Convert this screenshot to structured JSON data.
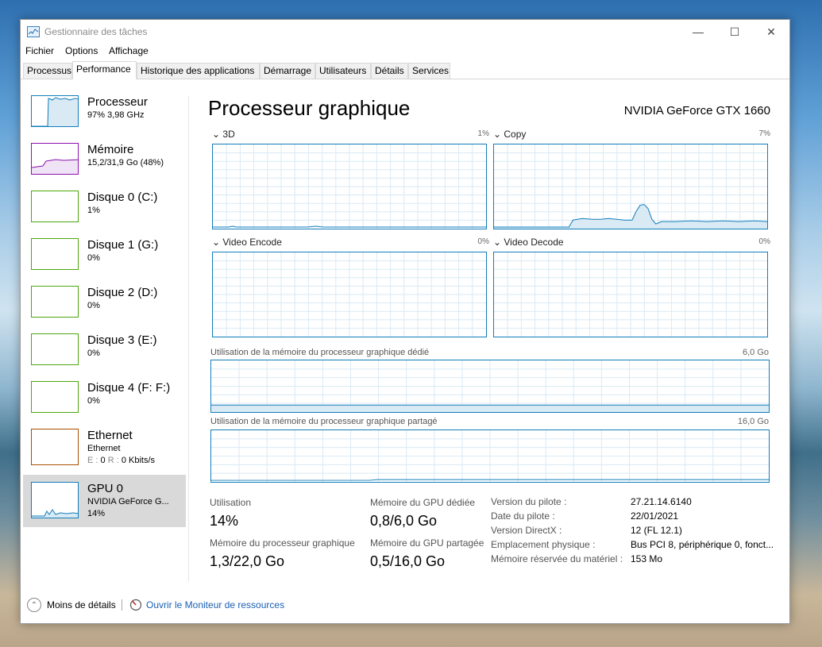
{
  "window": {
    "title": "Gestionnaire des tâches",
    "controls": {
      "minimize": "—",
      "maximize": "☐",
      "close": "✕"
    }
  },
  "menu": [
    "Fichier",
    "Options",
    "Affichage"
  ],
  "tabs": [
    "Processus",
    "Performance",
    "Historique des applications",
    "Démarrage",
    "Utilisateurs",
    "Détails",
    "Services"
  ],
  "sidebar": {
    "items": [
      {
        "name": "Processeur",
        "sub": "97% 3,98 GHz",
        "color": "#117dbb"
      },
      {
        "name": "Mémoire",
        "sub": "15,2/31,9 Go (48%)",
        "color": "#8b12ae"
      },
      {
        "name": "Disque 0 (C:)",
        "sub": "1%",
        "color": "#4da60c"
      },
      {
        "name": "Disque 1 (G:)",
        "sub": "0%",
        "color": "#4da60c"
      },
      {
        "name": "Disque 2 (D:)",
        "sub": "0%",
        "color": "#4da60c"
      },
      {
        "name": "Disque 3 (E:)",
        "sub": "0%",
        "color": "#4da60c"
      },
      {
        "name": "Disque 4 (F: F:)",
        "sub": "0%",
        "color": "#4da60c"
      },
      {
        "name": "Ethernet",
        "sub": "Ethernet",
        "sub2_s_label": "E :",
        "sub2_s": "0",
        "sub2_r_label": "R :",
        "sub2_r": "0 Kbits/s",
        "color": "#a74f01"
      },
      {
        "name": "GPU 0",
        "sub": "NVIDIA GeForce G...",
        "sub2": "14%",
        "color": "#117dbb"
      }
    ]
  },
  "main": {
    "title": "Processeur graphique",
    "device": "NVIDIA GeForce GTX 1660",
    "engines": [
      {
        "label": "3D",
        "pct": "1%"
      },
      {
        "label": "Copy",
        "pct": "7%"
      },
      {
        "label": "Video Encode",
        "pct": "0%"
      },
      {
        "label": "Video Decode",
        "pct": "0%"
      }
    ],
    "memory_graphs": [
      {
        "label": "Utilisation de la mémoire du processeur graphique dédié",
        "max": "6,0 Go"
      },
      {
        "label": "Utilisation de la mémoire du processeur graphique partagé",
        "max": "16,0 Go"
      }
    ],
    "stats": {
      "utilisation_label": "Utilisation",
      "utilisation": "14%",
      "dedicated_label": "Mémoire du GPU dédiée",
      "dedicated": "0,8/6,0 Go",
      "gpu_mem_label": "Mémoire du processeur graphique",
      "gpu_mem": "1,3/22,0 Go",
      "shared_label": "Mémoire du GPU partagée",
      "shared": "0,5/16,0 Go"
    },
    "details": [
      {
        "label": "Version du pilote :",
        "value": "27.21.14.6140"
      },
      {
        "label": "Date du pilote :",
        "value": "22/01/2021"
      },
      {
        "label": "Version DirectX :",
        "value": "12 (FL 12.1)"
      },
      {
        "label": "Emplacement physique :",
        "value": "Bus PCI 8, périphérique 0, fonct..."
      },
      {
        "label": "Mémoire réservée du matériel :",
        "value": "153 Mo"
      }
    ]
  },
  "footer": {
    "less_details": "Moins de détails",
    "open_monitor": "Ouvrir le Moniteur de ressources"
  },
  "colors": {
    "gpu_line": "#117dbb",
    "grid": "#d9eaf5",
    "selected_bg": "#d9d9d9"
  }
}
